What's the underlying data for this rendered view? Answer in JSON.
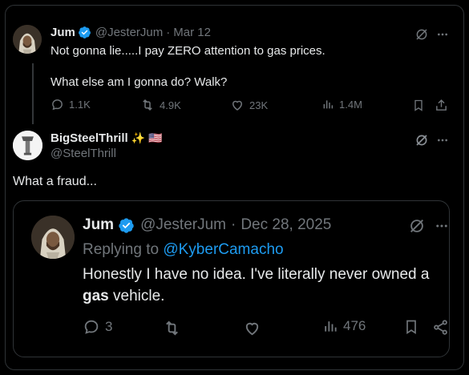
{
  "post1": {
    "name": "Jum",
    "handle": "@JesterJum",
    "sep": "·",
    "date": "Mar 12",
    "line1": "Not gonna lie.....I pay ZERO attention to gas prices.",
    "line2": "What else am I gonna do? Walk?",
    "replies": "1.1K",
    "reposts": "4.9K",
    "likes": "23K",
    "views": "1.4M"
  },
  "post2": {
    "name": "BigSteelThrill",
    "emoji": "✨ 🇺🇸",
    "handle": "@SteelThrill",
    "text": "What a fraud..."
  },
  "quote": {
    "name": "Jum",
    "handle": "@JesterJum",
    "sep": "·",
    "date": "Dec 28, 2025",
    "replying_prefix": "Replying to",
    "replying_to": "@KyberCamacho",
    "text_part1": "Honestly I have no idea. I've literally never owned a",
    "text_bold": "gas",
    "text_part2": "vehicle.",
    "replies": "3",
    "views": "476"
  },
  "icons": {
    "grok": "grok-icon",
    "more": "more-icon",
    "verified": "verified-badge-icon",
    "reply": "reply-icon",
    "repost": "repost-icon",
    "like": "like-icon",
    "views": "views-icon",
    "bookmark": "bookmark-icon",
    "share": "share-icon"
  },
  "colors": {
    "background": "#000000",
    "text": "#e7e9ea",
    "muted": "#71767b",
    "link": "#1d9bf0",
    "border": "#2f3336"
  }
}
